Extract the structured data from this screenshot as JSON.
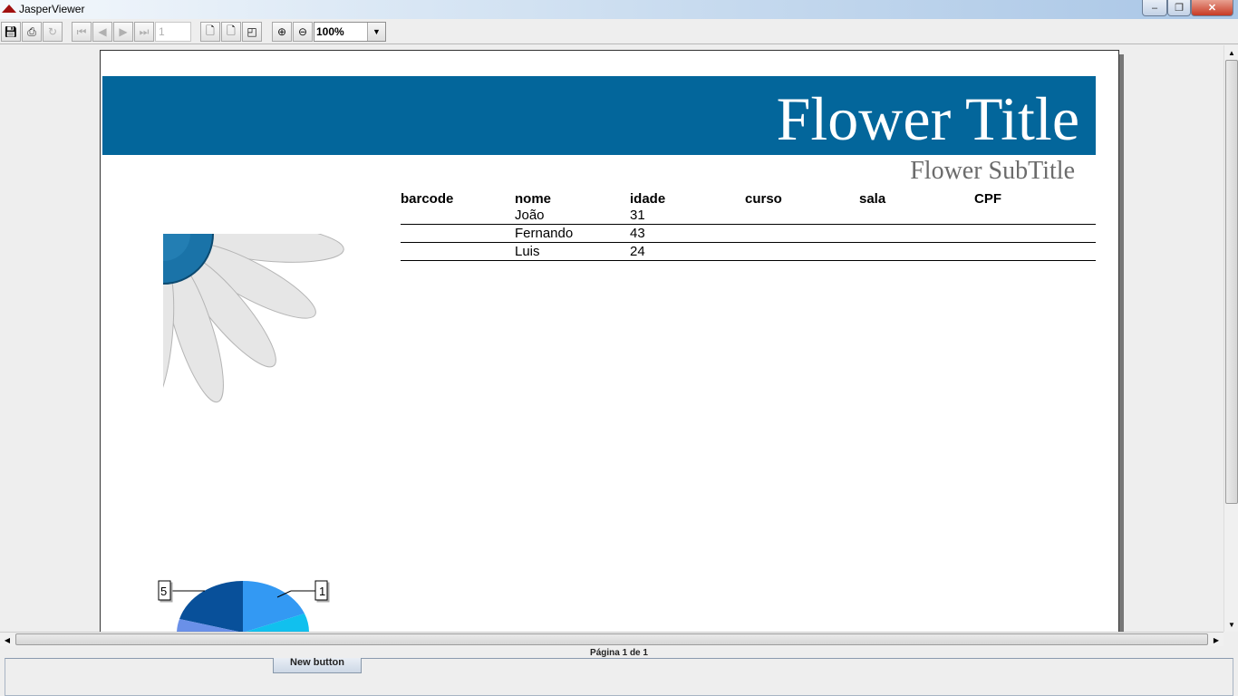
{
  "window": {
    "title": "JasperViewer",
    "minimize": "–",
    "restore": "❐",
    "close": "✕"
  },
  "toolbar": {
    "page_number": "1",
    "zoom_value": "100%"
  },
  "report": {
    "title": "Flower Title",
    "subtitle": "Flower SubTitle",
    "columns": [
      "barcode",
      "nome",
      "idade",
      "curso",
      "sala",
      "CPF"
    ],
    "rows": [
      {
        "nome": "João",
        "idade": "31"
      },
      {
        "nome": "Fernando",
        "idade": "43"
      },
      {
        "nome": "Luis",
        "idade": "24"
      }
    ],
    "pie_labels": {
      "left": "5",
      "right": "1"
    },
    "colors": {
      "banner": "#03669b",
      "flower_center": "#1a73a8"
    }
  },
  "status": {
    "page_info": "Página 1 de 1"
  },
  "bottom": {
    "button_label": "New button"
  }
}
